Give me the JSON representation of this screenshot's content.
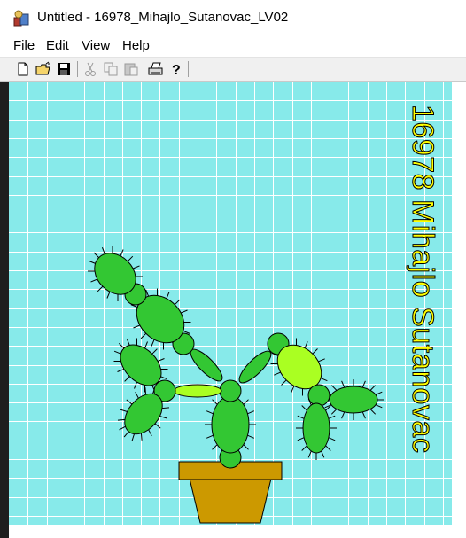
{
  "window": {
    "title": "Untitled - 16978_Mihajlo_Sutanovac_LV02"
  },
  "menu": [
    "File",
    "Edit",
    "View",
    "Help"
  ],
  "toolbar": {
    "buttons": [
      "new-file-icon",
      "open-folder-icon",
      "save-icon",
      "cut-icon",
      "copy-icon",
      "paste-icon",
      "print-icon",
      "help-icon"
    ]
  },
  "drawing": {
    "caption": "16978 Mihajlo Sutanovac",
    "colors": {
      "background": "#87eaea",
      "grid": "#ffffff",
      "cactus_dark": "#33c733",
      "cactus_light": "#aaff22",
      "pot": "#cc9900",
      "text": "#ffff00"
    }
  }
}
